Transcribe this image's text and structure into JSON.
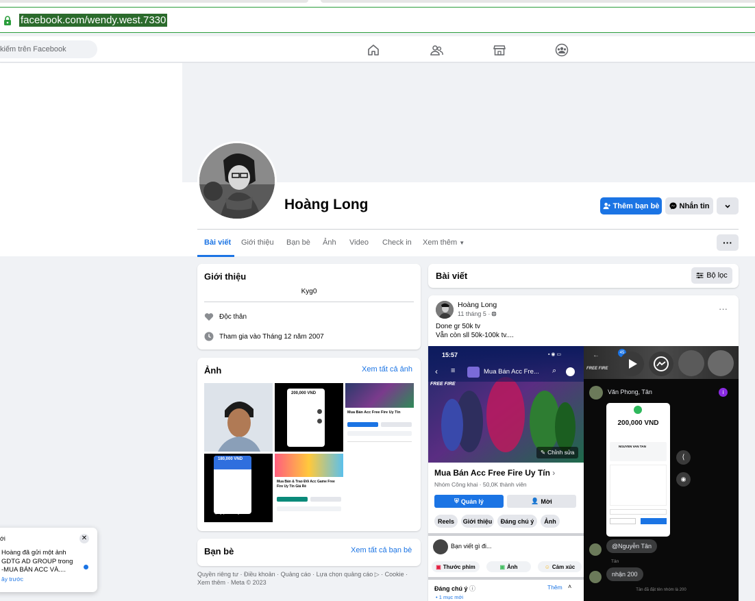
{
  "browser": {
    "url": "facebook.com/wendy.west.7330"
  },
  "header": {
    "search_placeholder": "kiếm trên Facebook"
  },
  "profile": {
    "name": "Hoàng Long",
    "add_friend_label": "Thêm bạn bè",
    "message_label": "Nhắn tin"
  },
  "tabs": {
    "posts": "Bài viết",
    "about": "Giới thiệu",
    "friends": "Bạn bè",
    "photos": "Ảnh",
    "video": "Video",
    "checkin": "Check in",
    "more": "Xem thêm"
  },
  "intro": {
    "title": "Giới thiệu",
    "bio": "Kyg0",
    "relationship": "Độc thân",
    "joined": "Tham gia vào Tháng 12 năm 2007"
  },
  "photos_card": {
    "title": "Ảnh",
    "see_all": "Xem tất cả ảnh",
    "thumb_amount": "200,000 VND",
    "thumb_amount_2": "180,000 VND",
    "thumb_group_title": "Mua Bán Acc Free Fire Uy Tín",
    "thumb_group_title_2": "Mua Bán & Trao Đổi Acc Game Free Fire Uy Tín Giá Rẻ",
    "thumb_signature": "@Nguyễn Trường"
  },
  "friends_card": {
    "title": "Bạn bè",
    "see_all": "Xem tất cả bạn bè"
  },
  "footer": {
    "text": "Quyền riêng tư · Điều khoản · Quảng cáo · Lựa chọn quảng cáo ▷ · Cookie · Xem thêm · Meta © 2023"
  },
  "posts_card": {
    "title": "Bài viết",
    "filter_label": "Bộ lọc"
  },
  "post": {
    "author": "Hoàng Long",
    "time": "11 tháng 5 ·",
    "line1": "Done gr 50k tv",
    "line2": "Vẫn còn sll 50k-100k tv....",
    "screenshot_left": {
      "time": "15:57",
      "group_name": "Mua Bán Acc Fre...",
      "edit_label": "Chỉnh sửa",
      "group_title": "Mua Bán Acc Free Fire Uy Tín",
      "group_meta": "Nhóm Công khai · 50,0K thành viên",
      "manage_label": "Quản lý",
      "invite_label": "Mời",
      "pills": [
        "Reels",
        "Giới thiệu",
        "Đáng chú ý",
        "Ảnh"
      ],
      "write_prompt": "Bạn viết gì đi...",
      "reel_label": "Thước phim",
      "photo_label": "Ảnh",
      "feeling_label": "Cảm xúc",
      "featured_label": "Đáng chú ý",
      "featured_more": "Thêm",
      "featured_count": "1 mục mới",
      "brand": "FREE FIRE"
    },
    "screenshot_right": {
      "badge": "45",
      "chat_name": "Văn Phong, Tân",
      "amount": "200,000 VND",
      "recipient": "NGUYEN VAN TAN",
      "signature": "@Nguyễn Tân",
      "sender": "Tân",
      "reply": "nhận 200",
      "footer_note": "Tân đã đặt tên nhóm là 200"
    }
  },
  "notification": {
    "prefix": "ới",
    "line1": "Hoàng đã gửi một ảnh",
    "line2": "GDTG AD GROUP trong",
    "line3": "-MUA BÁN ACC VÀ....",
    "time": "ây trước"
  },
  "colors": {
    "accent": "#1b74e4",
    "page_bg": "#f0f2f5",
    "url_highlight": "#2b6b2c"
  }
}
